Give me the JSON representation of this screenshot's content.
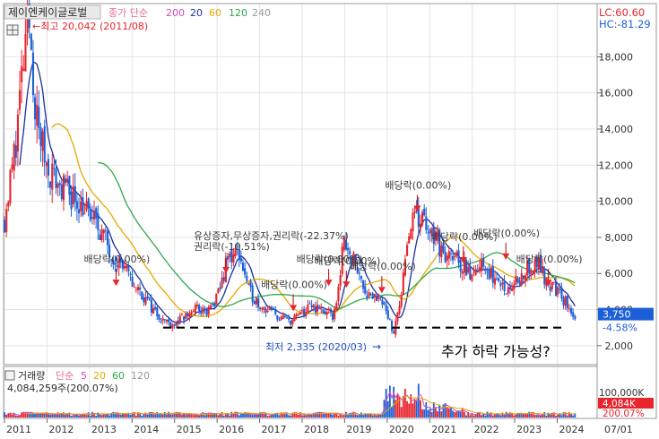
{
  "price_panel": {
    "title": "제이엔케이글로벌",
    "ma_label": "종가 단순",
    "ma_periods": [
      "200",
      "20",
      "60",
      "120",
      "240"
    ],
    "lc_label": "LC:60.60",
    "hc_label": "HC:-81.29",
    "current_price": "3,750",
    "current_change": "-4.58%",
    "high_annotation": "←최고 20,042 (2011/08)",
    "low_annotation": "최저 2,335 (2020/03)",
    "low_arrow": "→",
    "outlook_text": "추가 하락 가능성?"
  },
  "volume_panel": {
    "title": "거래량",
    "ma_label": "단순",
    "ma_periods": [
      "5",
      "20",
      "60",
      "120"
    ],
    "volume_value": "4,084,259주(200.07%)",
    "max_label": "100,000K",
    "current_volume": "4,084K",
    "current_volume_pct": "200.07%"
  },
  "colors": {
    "up": "#e8242c",
    "down": "#1c5fd8",
    "ma20": "#1c2f9e",
    "ma60": "#e8a800",
    "ma120": "#2ea84a",
    "annotation": "#2150c8",
    "high_annotation": "#e8242c",
    "support_line": "#000000",
    "grid": "#e4e4e4"
  },
  "chart_data": {
    "type": "candlestick",
    "y_axis": {
      "ticks": [
        "2,000",
        "4,000",
        "6,000",
        "8,000",
        "10,000",
        "12,000",
        "14,000",
        "16,000",
        "18,000"
      ],
      "range": [
        1000,
        20900
      ],
      "scale": "linear",
      "position": "right"
    },
    "x_axis": {
      "ticks": [
        "2011",
        "2012",
        "2013",
        "2014",
        "2015",
        "2016",
        "2017",
        "2018",
        "2019",
        "2020",
        "2021",
        "2022",
        "2023",
        "2024",
        "07/01"
      ],
      "range": [
        "2011-01",
        "2024-12"
      ]
    },
    "grid": true,
    "support_level": 3000,
    "price_path": [
      [
        "2011-01",
        9000
      ],
      [
        "2011-04",
        13000
      ],
      [
        "2011-06",
        17000
      ],
      [
        "2011-08",
        19800
      ],
      [
        "2011-10",
        14500
      ],
      [
        "2012-01",
        12000
      ],
      [
        "2012-04",
        11000
      ],
      [
        "2012-07",
        10500
      ],
      [
        "2012-10",
        10000
      ],
      [
        "2013-01",
        9200
      ],
      [
        "2013-04",
        8500
      ],
      [
        "2013-07",
        7200
      ],
      [
        "2013-10",
        6500
      ],
      [
        "2014-01",
        5500
      ],
      [
        "2014-04",
        4800
      ],
      [
        "2014-07",
        4000
      ],
      [
        "2014-10",
        3400
      ],
      [
        "2015-01",
        3200
      ],
      [
        "2015-04",
        3600
      ],
      [
        "2015-07",
        4100
      ],
      [
        "2015-10",
        3800
      ],
      [
        "2016-01",
        4600
      ],
      [
        "2016-04",
        6800
      ],
      [
        "2016-07",
        7300
      ],
      [
        "2016-10",
        5000
      ],
      [
        "2017-01",
        4300
      ],
      [
        "2017-04",
        3900
      ],
      [
        "2017-07",
        3500
      ],
      [
        "2017-10",
        3400
      ],
      [
        "2018-01",
        3800
      ],
      [
        "2018-04",
        4200
      ],
      [
        "2018-07",
        3900
      ],
      [
        "2018-10",
        3600
      ],
      [
        "2019-01",
        8000
      ],
      [
        "2019-04",
        6500
      ],
      [
        "2019-07",
        5000
      ],
      [
        "2019-10",
        4700
      ],
      [
        "2020-01",
        3800
      ],
      [
        "2020-03",
        2700
      ],
      [
        "2020-05",
        5000
      ],
      [
        "2020-07",
        8500
      ],
      [
        "2020-10",
        9200
      ],
      [
        "2021-01",
        8600
      ],
      [
        "2021-04",
        7300
      ],
      [
        "2021-07",
        7000
      ],
      [
        "2021-10",
        6500
      ],
      [
        "2022-01",
        6000
      ],
      [
        "2022-04",
        6500
      ],
      [
        "2022-07",
        5700
      ],
      [
        "2022-10",
        5200
      ],
      [
        "2023-01",
        5500
      ],
      [
        "2023-04",
        6200
      ],
      [
        "2023-07",
        6700
      ],
      [
        "2023-10",
        5600
      ],
      [
        "2024-01",
        5000
      ],
      [
        "2024-03",
        4500
      ],
      [
        "2024-05",
        3900
      ],
      [
        "2024-06",
        3750
      ]
    ],
    "annotations": [
      {
        "text": "배당락(0.00%)",
        "date": "2013-09",
        "price": 6600
      },
      {
        "text": "유상증자,무상증자,권리락(-22.37%)",
        "date": "2016-04",
        "price": 7900
      },
      {
        "text": "권리락(-10.51%)",
        "date": "2016-04",
        "price": 7300
      },
      {
        "text": "배당락(0.00%)",
        "date": "2017-11",
        "price": 5200
      },
      {
        "text": "배당락(0.00%)",
        "date": "2018-09",
        "price": 6600
      },
      {
        "text": "배당락(0.00%)",
        "date": "2019-02",
        "price": 6500
      },
      {
        "text": "배당락(0.00%)",
        "date": "2019-12",
        "price": 6200
      },
      {
        "text": "배당락(0.00%)",
        "date": "2020-10",
        "price": 10700
      },
      {
        "text": "배당락(0.00%)",
        "date": "2021-11",
        "price": 7850
      },
      {
        "text": "배당락(0.00%)",
        "date": "2022-11",
        "price": 8050
      },
      {
        "text": "배당락(0.00%)",
        "date": "2023-11",
        "price": 6600
      }
    ]
  }
}
